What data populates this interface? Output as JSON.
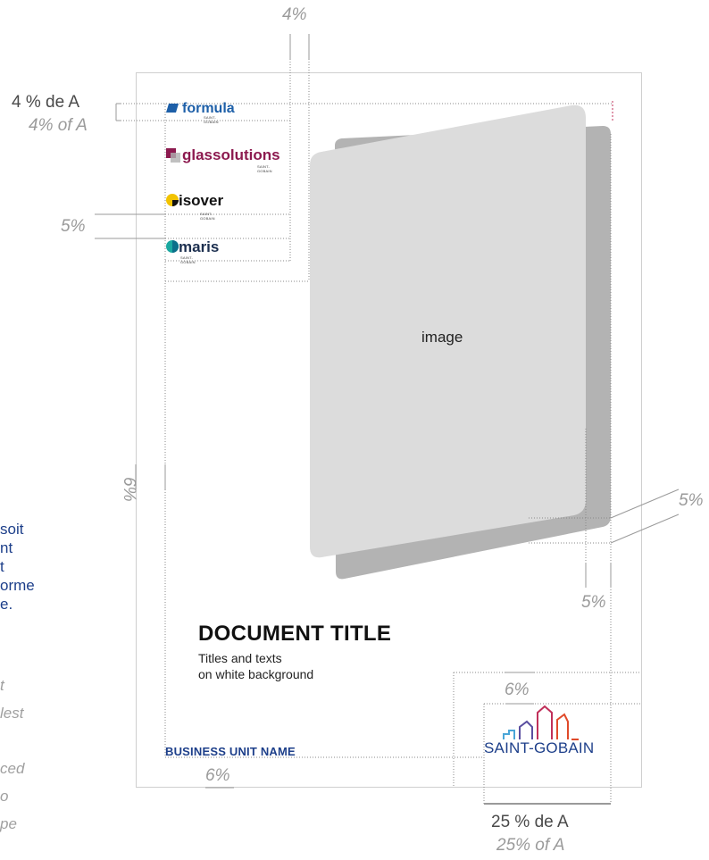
{
  "measures": {
    "top_percent": "4%",
    "logo_height_fr": "4 % de A",
    "logo_height_en": "4% of A",
    "logo_gap": "5%",
    "left_margin": "6%",
    "right_margin": "5%",
    "bottom_image_margin": "5%",
    "sg_logo_margin": "6%",
    "bottom_margin": "6%",
    "sg_width_fr": "25 % de A",
    "sg_width_en": "25% of A"
  },
  "page": {
    "image_label": "image",
    "document_title": "DOCUMENT TITLE",
    "subtitle": "Titles and texts\non white background",
    "business_unit": "BUSINESS UNIT NAME"
  },
  "logos": {
    "formula": {
      "name": "formula",
      "sub": "SAINT-GOBAIN",
      "color": "#1d5fa8"
    },
    "glassolutions": {
      "name": "glassolutions",
      "sub": "SAINT-GOBAIN",
      "color": "#8c1a4f"
    },
    "isover": {
      "name": "isover",
      "sub": "SAINT-GOBAIN",
      "color": "#111111"
    },
    "maris": {
      "name": "maris",
      "sub": "SAINT-GOBAIN",
      "color": "#1c2f4f"
    },
    "saint_gobain": {
      "name": "SAINT-GOBAIN",
      "color": "#1d3f8a"
    }
  },
  "left_notes": {
    "blue_text": "soit\nnt\nt\norme\ne.",
    "gray_text": "t\nlest\n\nced\no\npe"
  },
  "colors": {
    "image_front": "#dcdcdc",
    "image_back": "#b3b3b3",
    "guides": "#8a8a8a",
    "brand_blue": "#1d3f8a"
  }
}
